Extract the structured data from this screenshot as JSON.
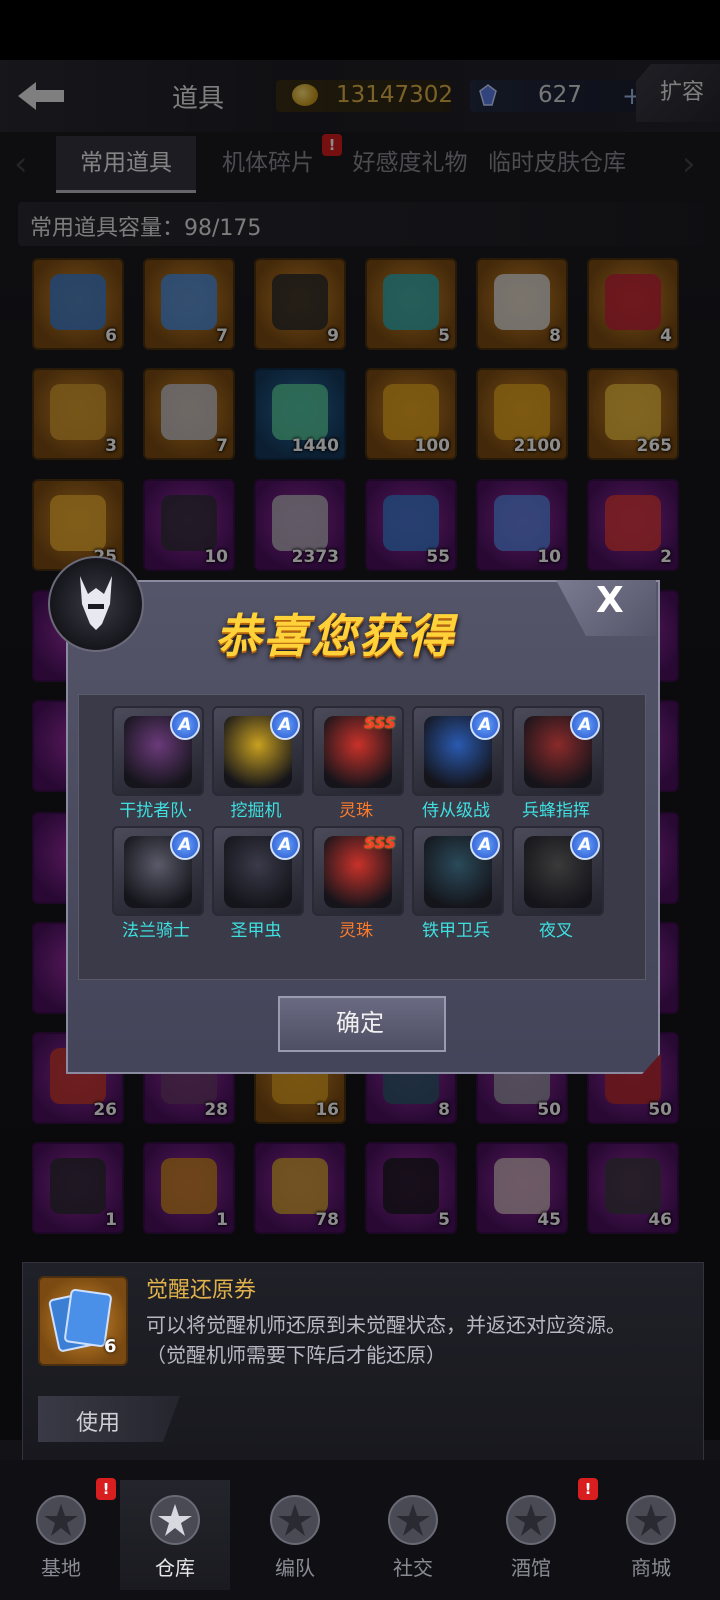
{
  "header": {
    "title": "道具",
    "coins": "13147302",
    "gems": "627",
    "plus": "+",
    "expand": "扩容"
  },
  "tabs": [
    {
      "label": "常用道具",
      "active": true
    },
    {
      "label": "机体碎片",
      "badge": "!"
    },
    {
      "label": "好感度礼物"
    },
    {
      "label": "临时皮肤仓库"
    }
  ],
  "capacity": "常用道具容量：98/175",
  "grid_counts": {
    "row1": [
      "6",
      "7",
      "9",
      "5",
      "8",
      "4"
    ],
    "row2": [
      "3",
      "7",
      "1440",
      "100",
      "2100",
      "265"
    ],
    "row3": [
      "25",
      "10",
      "2373",
      "55",
      "10",
      "2"
    ],
    "row9": [
      "26",
      "28",
      "16",
      "8",
      "50",
      "50"
    ],
    "row10": [
      "1",
      "1",
      "78",
      "5",
      "45",
      "46"
    ]
  },
  "dialog": {
    "title": "恭喜您获得",
    "close": "X",
    "rewards": [
      {
        "name": "干扰者队·",
        "rank": "A",
        "color": "cyan"
      },
      {
        "name": "挖掘机",
        "rank": "A",
        "color": "cyan"
      },
      {
        "name": "灵珠",
        "rank": "SSS",
        "color": "orange"
      },
      {
        "name": "侍从级战",
        "rank": "A",
        "color": "cyan"
      },
      {
        "name": "兵蜂指挥",
        "rank": "A",
        "color": "cyan"
      },
      {
        "name": "法兰骑士",
        "rank": "A",
        "color": "cyan"
      },
      {
        "name": "圣甲虫",
        "rank": "A",
        "color": "cyan"
      },
      {
        "name": "灵珠",
        "rank": "SSS",
        "color": "orange"
      },
      {
        "name": "铁甲卫兵",
        "rank": "A",
        "color": "cyan"
      },
      {
        "name": "夜叉",
        "rank": "A",
        "color": "cyan"
      }
    ],
    "confirm": "确定"
  },
  "detail": {
    "name": "觉醒还原券",
    "count": "6",
    "desc1": "可以将觉醒机师还原到未觉醒状态，并返还对应资源。",
    "desc2": "（觉醒机师需要下阵后才能还原）",
    "use": "使用"
  },
  "nav": [
    {
      "label": "基地",
      "icon": "star-emblem-icon",
      "badge": "!"
    },
    {
      "label": "仓库",
      "icon": "warehouse-icon",
      "active": true
    },
    {
      "label": "编队",
      "icon": "helmet-icon"
    },
    {
      "label": "社交",
      "icon": "handshake-icon"
    },
    {
      "label": "酒馆",
      "icon": "robot-bartender-icon",
      "badge": "!"
    },
    {
      "label": "商城",
      "icon": "shop-robot-icon"
    }
  ],
  "colors": {
    "accent_gold": "#ffd23a",
    "name_cyan": "#3ee0e0",
    "name_orange": "#ff7a2a",
    "badge_red": "#d81e1e"
  }
}
